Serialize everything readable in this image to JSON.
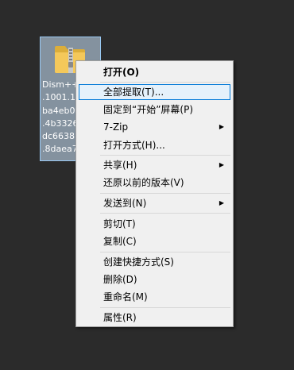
{
  "desktop": {
    "file": {
      "icon": "zip-folder-icon",
      "label_lines": [
        "Dism++",
        ".1001.1",
        "ba4eb0",
        ".4b3326",
        "dc6638",
        ".8daea7"
      ]
    }
  },
  "context_menu": {
    "items": [
      {
        "label": "打开(O)",
        "bold": true
      },
      {
        "label": "全部提取(T)...",
        "highlight": true
      },
      {
        "label": "固定到“开始”屏幕(P)"
      },
      {
        "label": "7-Zip",
        "submenu": true
      },
      {
        "label": "打开方式(H)..."
      },
      {
        "label": "共享(H)",
        "submenu": true
      },
      {
        "label": "还原以前的版本(V)"
      },
      {
        "label": "发送到(N)",
        "submenu": true
      },
      {
        "label": "剪切(T)"
      },
      {
        "label": "复制(C)"
      },
      {
        "label": "创建快捷方式(S)"
      },
      {
        "label": "删除(D)"
      },
      {
        "label": "重命名(M)"
      },
      {
        "label": "属性(R)"
      }
    ]
  },
  "colors": {
    "desktop_bg": "#2b2b2b",
    "menu_bg": "#f0f0f0",
    "highlight_bg": "#e5f1fb",
    "highlight_border": "#0078d7",
    "selection_bg": "#cde8ff"
  }
}
